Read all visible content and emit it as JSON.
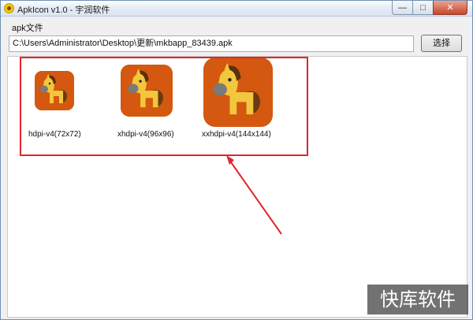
{
  "window": {
    "title": "ApkIcon v1.0 - 宇润软件",
    "controls": {
      "minimize": "—",
      "maximize": "□",
      "close": "✕"
    }
  },
  "form": {
    "apk_label": "apk文件",
    "path_value": "C:\\Users\\Administrator\\Desktop\\更新\\mkbapp_83439.apk",
    "select_button": "选择"
  },
  "icons": [
    {
      "label": "hdpi-v4(72x72)",
      "icon": "horse-app-icon"
    },
    {
      "label": "xhdpi-v4(96x96)",
      "icon": "horse-app-icon"
    },
    {
      "label": "xxhdpi-v4(144x144)",
      "icon": "horse-app-icon"
    }
  ],
  "watermark": "快库软件",
  "colors": {
    "icon_bg": "#d4580f",
    "horse_body": "#f2c63d",
    "highlight": "#e0262b"
  }
}
